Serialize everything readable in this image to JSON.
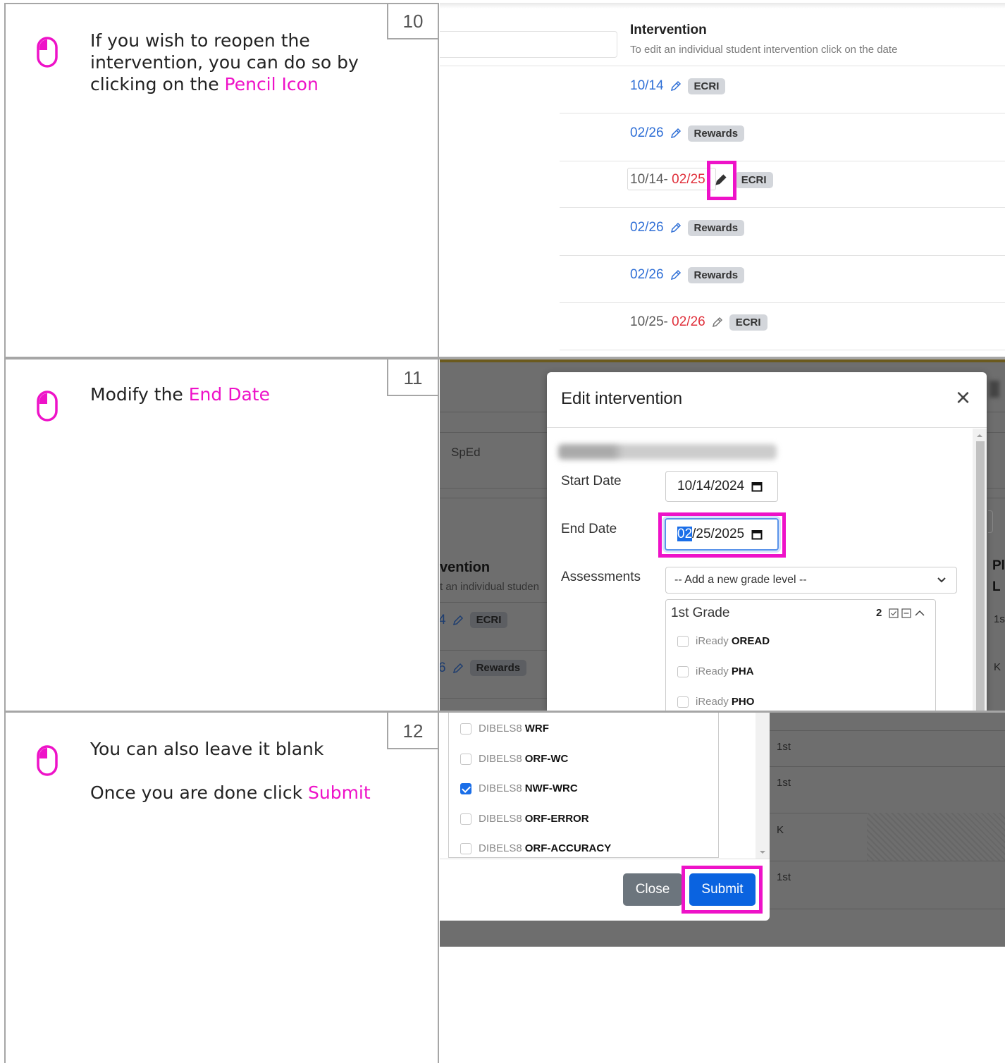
{
  "steps": [
    {
      "number": "10",
      "text_before": "If you wish to reopen the intervention, you can do so by clicking on the ",
      "highlight": "Pencil Icon"
    },
    {
      "number": "11",
      "text_before": "Modify the ",
      "highlight": "End Date"
    },
    {
      "number": "12",
      "line1": "You can also leave it blank",
      "line2_before": "Once you are done click ",
      "highlight": "Submit"
    }
  ],
  "shot10": {
    "header_title": "Intervention",
    "header_subtitle": "To edit an individual student intervention click on the date",
    "rows": [
      {
        "start": "10/14",
        "end": "",
        "tag": "ECRI"
      },
      {
        "start": "02/26",
        "end": "",
        "tag": "Rewards"
      },
      {
        "start": "10/14- ",
        "end": "02/25",
        "tag": "ECRI"
      },
      {
        "start": "02/26",
        "end": "",
        "tag": "Rewards"
      },
      {
        "start": "02/26",
        "end": "",
        "tag": "Rewards"
      },
      {
        "start": "10/25- ",
        "end": "02/26",
        "tag": "ECRI"
      }
    ]
  },
  "shot11": {
    "bg_sped": "SpEd",
    "bg_vention": "vention",
    "bg_sub": "t an individual studen",
    "bg_row1_tag": "ECRI",
    "bg_row1_num": "4",
    "bg_row2_tag": "Rewards",
    "bg_row2_num": "6",
    "bg_right_p": "Pl",
    "bg_right_l": "L",
    "bg_right_1s": "1s",
    "bg_right_k": "K",
    "modal_title": "Edit intervention",
    "close_symbol": "×",
    "start_label": "Start Date",
    "start_value": "10/14/2024",
    "end_label": "End Date",
    "end_value_sel": "02",
    "end_value_rest": "/25/2025",
    "assess_label": "Assessments",
    "grade_select": "-- Add a new grade level --",
    "grade_group": "1st Grade",
    "grade_count": "2",
    "items": [
      {
        "src": "iReady",
        "name": "OREAD"
      },
      {
        "src": "iReady",
        "name": "PHA"
      },
      {
        "src": "iReady",
        "name": "PHO"
      }
    ]
  },
  "shot12": {
    "items": [
      {
        "src": "DIBELS8",
        "name": "WRF",
        "checked": false
      },
      {
        "src": "DIBELS8",
        "name": "ORF-WC",
        "checked": false
      },
      {
        "src": "DIBELS8",
        "name": "NWF-WRC",
        "checked": true
      },
      {
        "src": "DIBELS8",
        "name": "ORF-ERROR",
        "checked": false
      },
      {
        "src": "DIBELS8",
        "name": "ORF-ACCURACY",
        "checked": false
      }
    ],
    "close_label": "Close",
    "submit_label": "Submit",
    "bg_grades": [
      "1st",
      "1st",
      "K",
      "1st"
    ]
  },
  "colors": {
    "highlight": "#ee12c8",
    "link_blue": "#2f6fd6",
    "date_red": "#e0313c",
    "submit_blue": "#0a63e0",
    "close_gray": "#6c757d"
  }
}
